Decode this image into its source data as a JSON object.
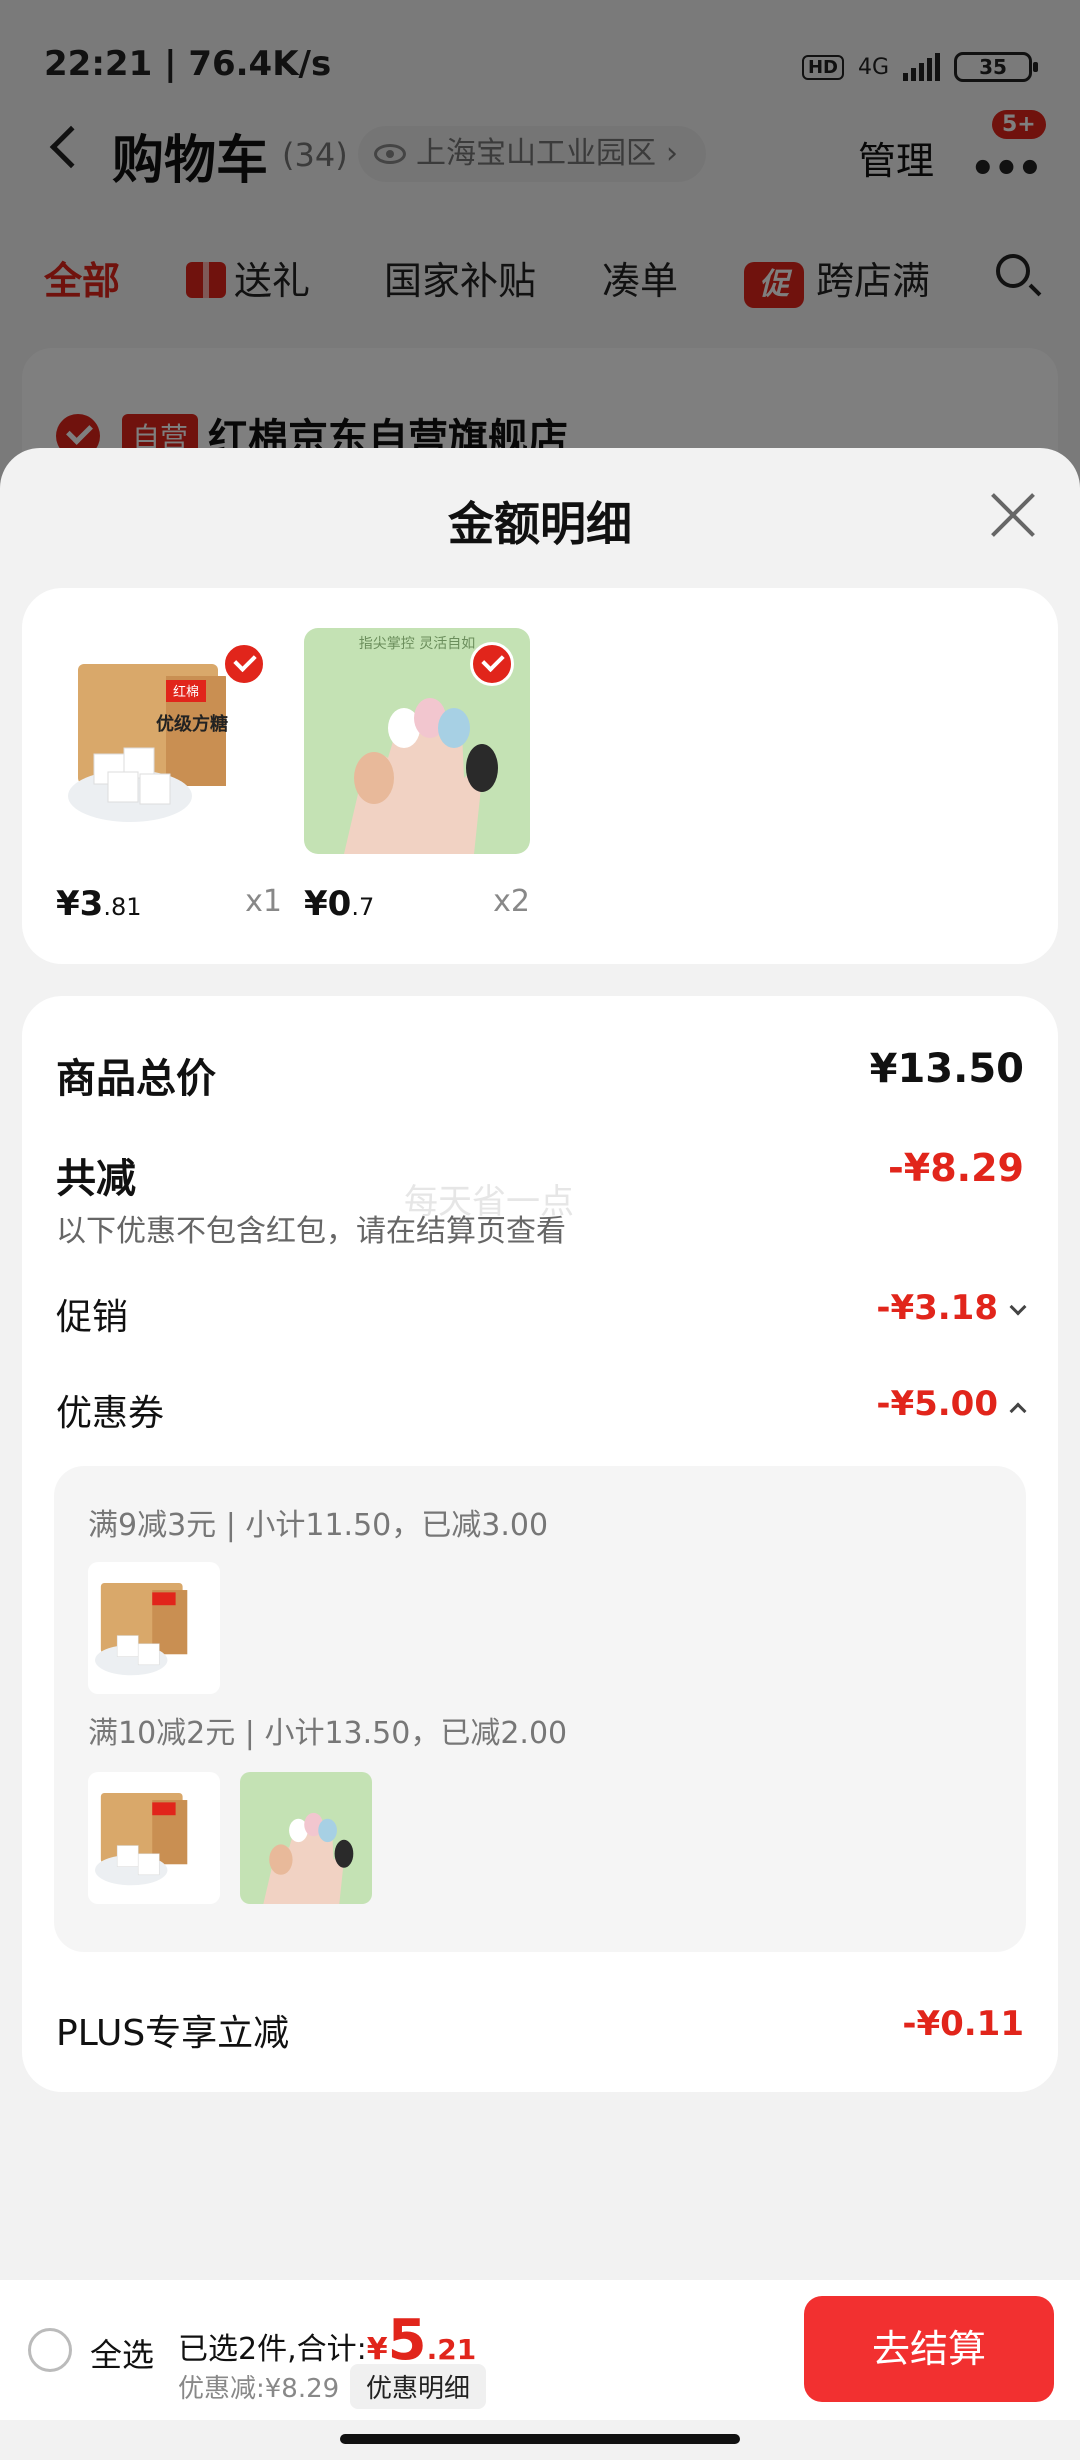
{
  "status_bar": {
    "time_speed": "22:21 | 76.4K/s",
    "hd": "HD",
    "network": "4G",
    "battery": "35"
  },
  "header": {
    "title": "购物车",
    "count": "(34)",
    "location": "上海宝山工业园区",
    "manage": "管理",
    "badge": "5+"
  },
  "tabs": [
    {
      "label": "全部"
    },
    {
      "label": "送礼"
    },
    {
      "label": "国家补贴"
    },
    {
      "label": "凑单"
    },
    {
      "label": "跨店满",
      "tag": "促"
    }
  ],
  "store": {
    "tag": "自营",
    "name": "红棉京东自营旗舰店"
  },
  "sheet": {
    "title": "金额明细",
    "products": [
      {
        "name": "红棉优级方糖",
        "price_int": "¥3",
        "price_dec": ".81",
        "qty": "x1",
        "box_brand": "红棉",
        "box_text": "优级方糖"
      },
      {
        "name": "指尖掌控 灵活自如",
        "price_int": "¥0",
        "price_dec": ".7",
        "qty": "x2",
        "banner": "指尖掌控 灵活自如"
      }
    ],
    "summary": {
      "total_label": "商品总价",
      "total_value": "¥13.50",
      "reduce_label": "共减",
      "reduce_value": "-¥8.29",
      "watermark": "每天省一点",
      "note": "以下优惠不包含红包，请在结算页查看",
      "promo_label": "促销",
      "promo_value": "-¥3.18",
      "coupon_label": "优惠券",
      "coupon_value": "-¥5.00",
      "coupons": [
        {
          "rule": "满9减3元 | 小计11.50，已减3.00"
        },
        {
          "rule": "满10减2元 | 小计13.50，已减2.00"
        }
      ],
      "plus_label": "PLUS专享立减",
      "plus_value": "-¥0.11"
    }
  },
  "bottom_bar": {
    "select_all": "全选",
    "selected_text": "已选2件,合计:",
    "yen": "¥",
    "total_int": "5",
    "total_dec": ".21",
    "discount_text": "优惠减:¥8.29",
    "detail_button": "优惠明细",
    "checkout": "去结算"
  },
  "colors": {
    "accent": "#e1251b",
    "checkout": "#f23030"
  }
}
